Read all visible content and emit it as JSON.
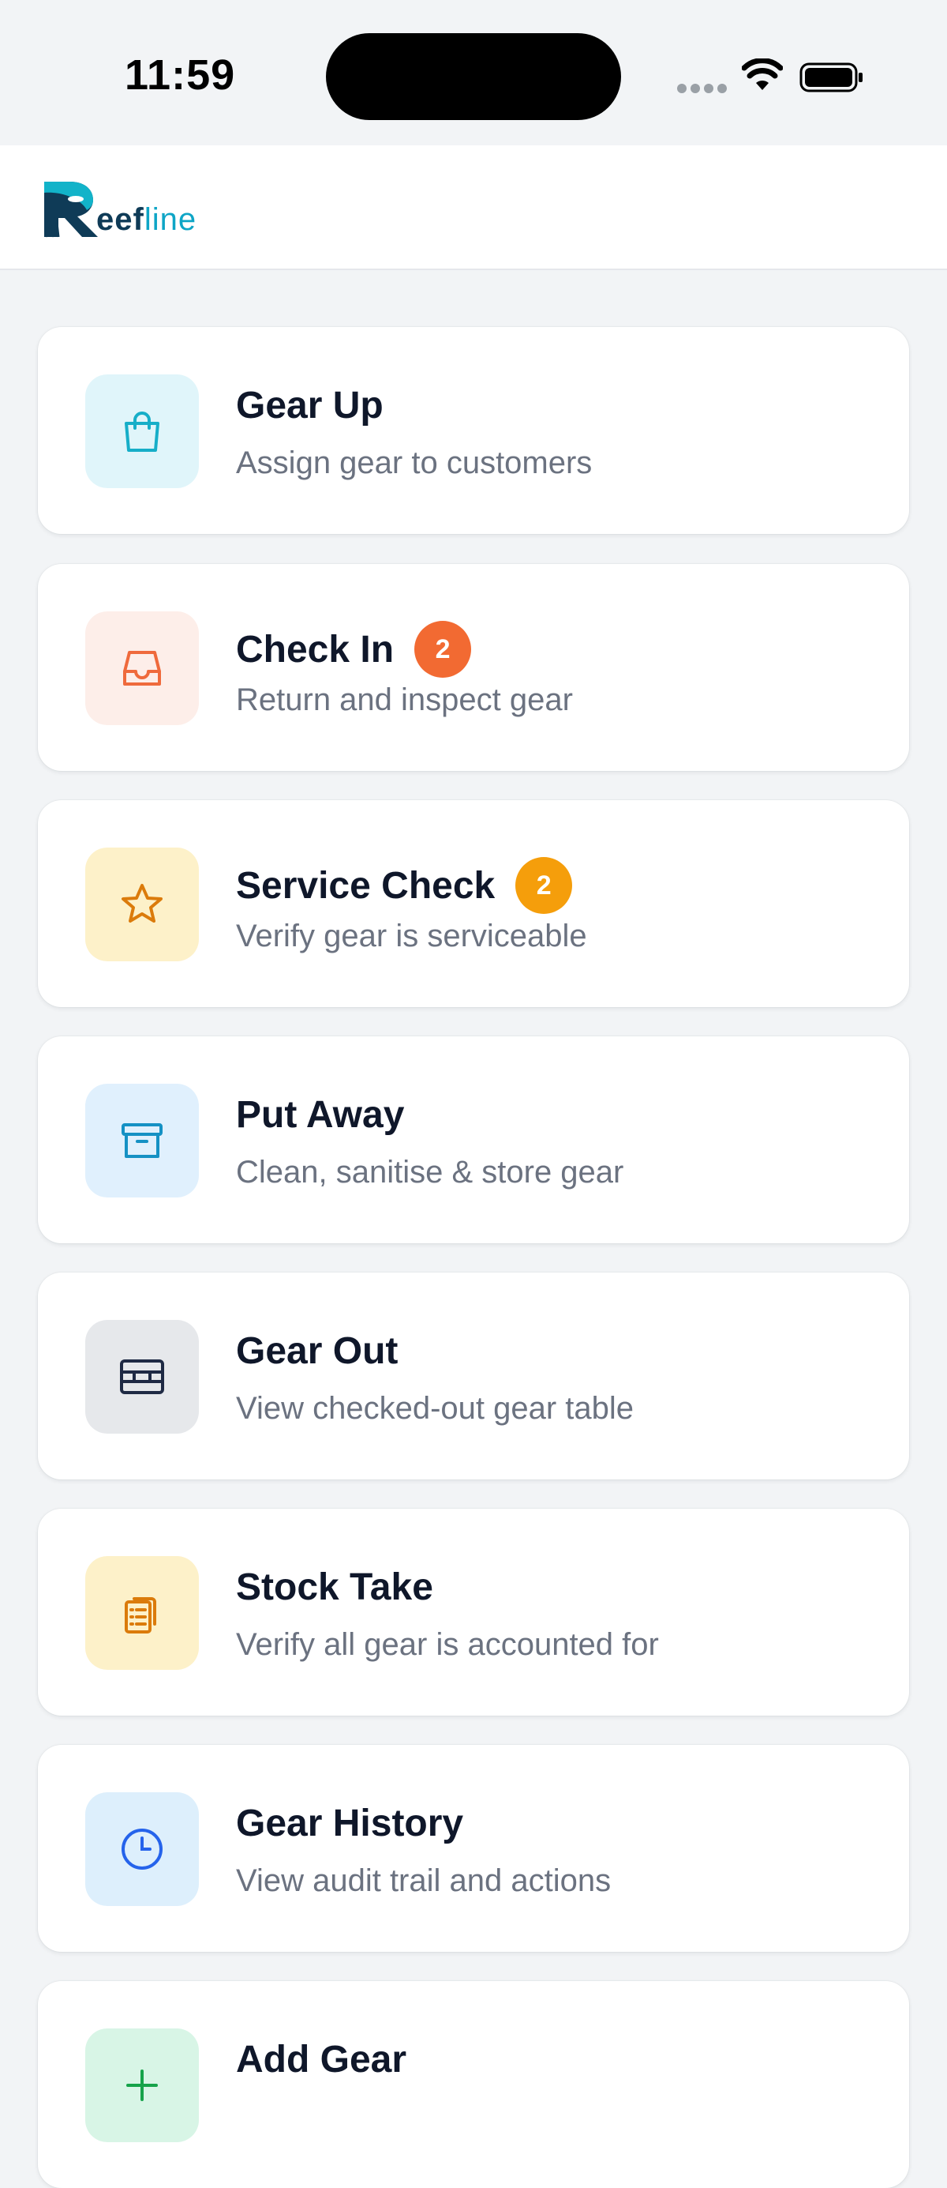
{
  "status_bar": {
    "time": "11:59"
  },
  "app": {
    "logo_part1": "eef",
    "logo_part2": "line",
    "logo_initial": "R"
  },
  "cards": [
    {
      "title": "Gear Up",
      "subtitle": "Assign gear to customers",
      "icon": "shopping-bag-icon",
      "tile_color": "#e0f5fa",
      "icon_color": "#16aec8",
      "badge": ""
    },
    {
      "title": "Check In",
      "subtitle": "Return and inspect gear",
      "icon": "inbox-icon",
      "tile_color": "#fdeee9",
      "icon_color": "#ef6a3c",
      "badge": "2",
      "badge_color": "#f26a32"
    },
    {
      "title": "Service Check",
      "subtitle": "Verify gear is serviceable",
      "icon": "star-icon",
      "tile_color": "#fdf1c9",
      "icon_color": "#db7b0b",
      "badge": "2",
      "badge_color": "#f59e0b"
    },
    {
      "title": "Put Away",
      "subtitle": "Clean, sanitise & store gear",
      "icon": "archive-box-icon",
      "tile_color": "#e0f0fd",
      "icon_color": "#1591c4",
      "badge": ""
    },
    {
      "title": "Gear Out",
      "subtitle": "View checked-out gear table",
      "icon": "table-icon",
      "tile_color": "#e6e8eb",
      "icon_color": "#1f2a44",
      "badge": ""
    },
    {
      "title": "Stock Take",
      "subtitle": "Verify all gear is accounted for",
      "icon": "clipboard-icon",
      "tile_color": "#fdf1c9",
      "icon_color": "#db7b0b",
      "badge": ""
    },
    {
      "title": "Gear History",
      "subtitle": "View audit trail and actions",
      "icon": "clock-icon",
      "tile_color": "#ddeffc",
      "icon_color": "#2563eb",
      "badge": ""
    },
    {
      "title": "Add Gear",
      "subtitle": "",
      "icon": "plus-icon",
      "tile_color": "#d8f5e6",
      "icon_color": "#16a34a",
      "badge": ""
    }
  ]
}
